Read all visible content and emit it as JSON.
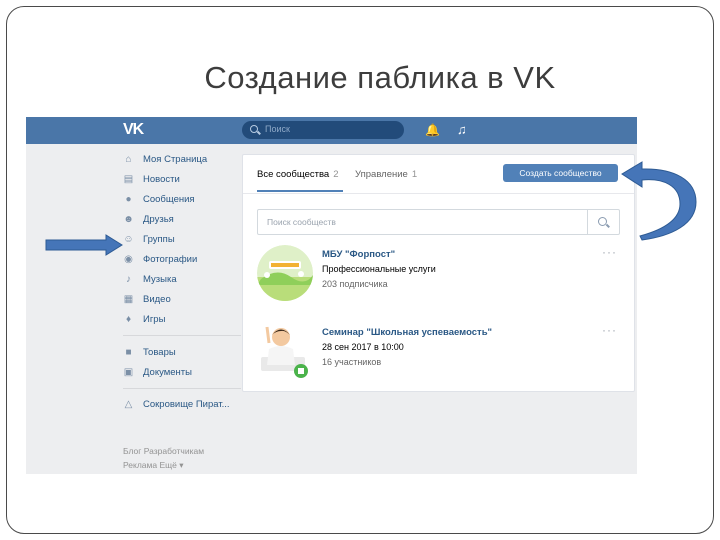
{
  "slide": {
    "title": "Создание паблика в VK"
  },
  "topbar": {
    "logo": "VK",
    "search_placeholder": "Поиск"
  },
  "sidebar": {
    "items": [
      {
        "label": "Моя Страница",
        "icon": "home-icon"
      },
      {
        "label": "Новости",
        "icon": "news-icon"
      },
      {
        "label": "Сообщения",
        "icon": "messages-icon"
      },
      {
        "label": "Друзья",
        "icon": "friends-icon"
      },
      {
        "label": "Группы",
        "icon": "groups-icon"
      },
      {
        "label": "Фотографии",
        "icon": "camera-icon"
      },
      {
        "label": "Музыка",
        "icon": "music-icon"
      },
      {
        "label": "Видео",
        "icon": "video-icon"
      },
      {
        "label": "Игры",
        "icon": "gamepad-icon"
      },
      {
        "label": "Товары",
        "icon": "bag-icon"
      },
      {
        "label": "Документы",
        "icon": "document-icon"
      },
      {
        "label": "Сокровище Пират...",
        "icon": "app-icon"
      }
    ],
    "footer_line1": "Блог  Разработчикам",
    "footer_line2": "Реклама  Ещё ▾"
  },
  "main": {
    "tabs": [
      {
        "label": "Все сообщества",
        "count": "2"
      },
      {
        "label": "Управление",
        "count": "1"
      }
    ],
    "create_button": "Создать сообщество",
    "search_placeholder": "Поиск сообществ",
    "groups": [
      {
        "name": "МБУ \"Форпост\"",
        "line2": "Профессиональные услуги",
        "line3": "203 подписчика"
      },
      {
        "name": "Семинар \"Школьная успеваемость\"",
        "line2": "28 сен 2017 в 10:00",
        "line3": "16 участников"
      }
    ],
    "more_glyph": "···"
  },
  "colors": {
    "header": "#4a76a8",
    "accent": "#5181b8",
    "link": "#2a5885",
    "arrow": "#4575b8",
    "page_bg": "#edeef0"
  }
}
